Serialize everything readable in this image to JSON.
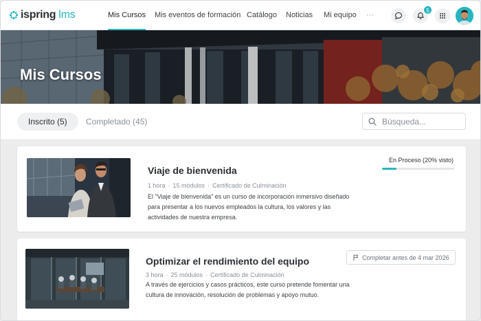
{
  "brand": {
    "name": "ispring",
    "product": "lms"
  },
  "nav": {
    "items": [
      {
        "label": "Mis Cursos"
      },
      {
        "label": "Mis eventos de formación"
      },
      {
        "label": "Catálogo"
      },
      {
        "label": "Noticias"
      },
      {
        "label": "Mi equipo"
      },
      {
        "label": "···"
      }
    ],
    "active_index": 0,
    "notifications_count": "5",
    "icons": [
      "chat-icon",
      "bell-icon",
      "apps-grid-icon"
    ]
  },
  "hero": {
    "title": "Mis Cursos"
  },
  "tabs": {
    "items": [
      {
        "label": "Inscrito (5)"
      },
      {
        "label": "Completado (45)"
      }
    ],
    "active_index": 0
  },
  "search": {
    "placeholder": "Búsqueda..."
  },
  "courses": [
    {
      "title": "Viaje de bienvenida",
      "meta": [
        "1 hora",
        "15 módulos",
        "Certificado de Culminación"
      ],
      "description": "El \"Viaje de bienvenida\" es un curso de incorporación inmersivo diseñado para presentar a los nuevos empleados la cultura, los valores y las actividades de nuestra empresa.",
      "status": "En Proceso (20% visto)",
      "progress": 0.2
    },
    {
      "title": "Optimizar el rendimiento del equipo",
      "meta": [
        "3 hora",
        "25 módulos",
        "Certificado de Culminación"
      ],
      "description": "A través de ejercicios y casos prácticos, este curso pretende fomentar una cultura de innovación, resolución de problemas y apoyo mutuo.",
      "deadline": "Completar antes de 4 mar 2026"
    }
  ],
  "colors": {
    "accent": "#26b5c0",
    "text": "#2b2f33",
    "muted": "#8a9096"
  }
}
